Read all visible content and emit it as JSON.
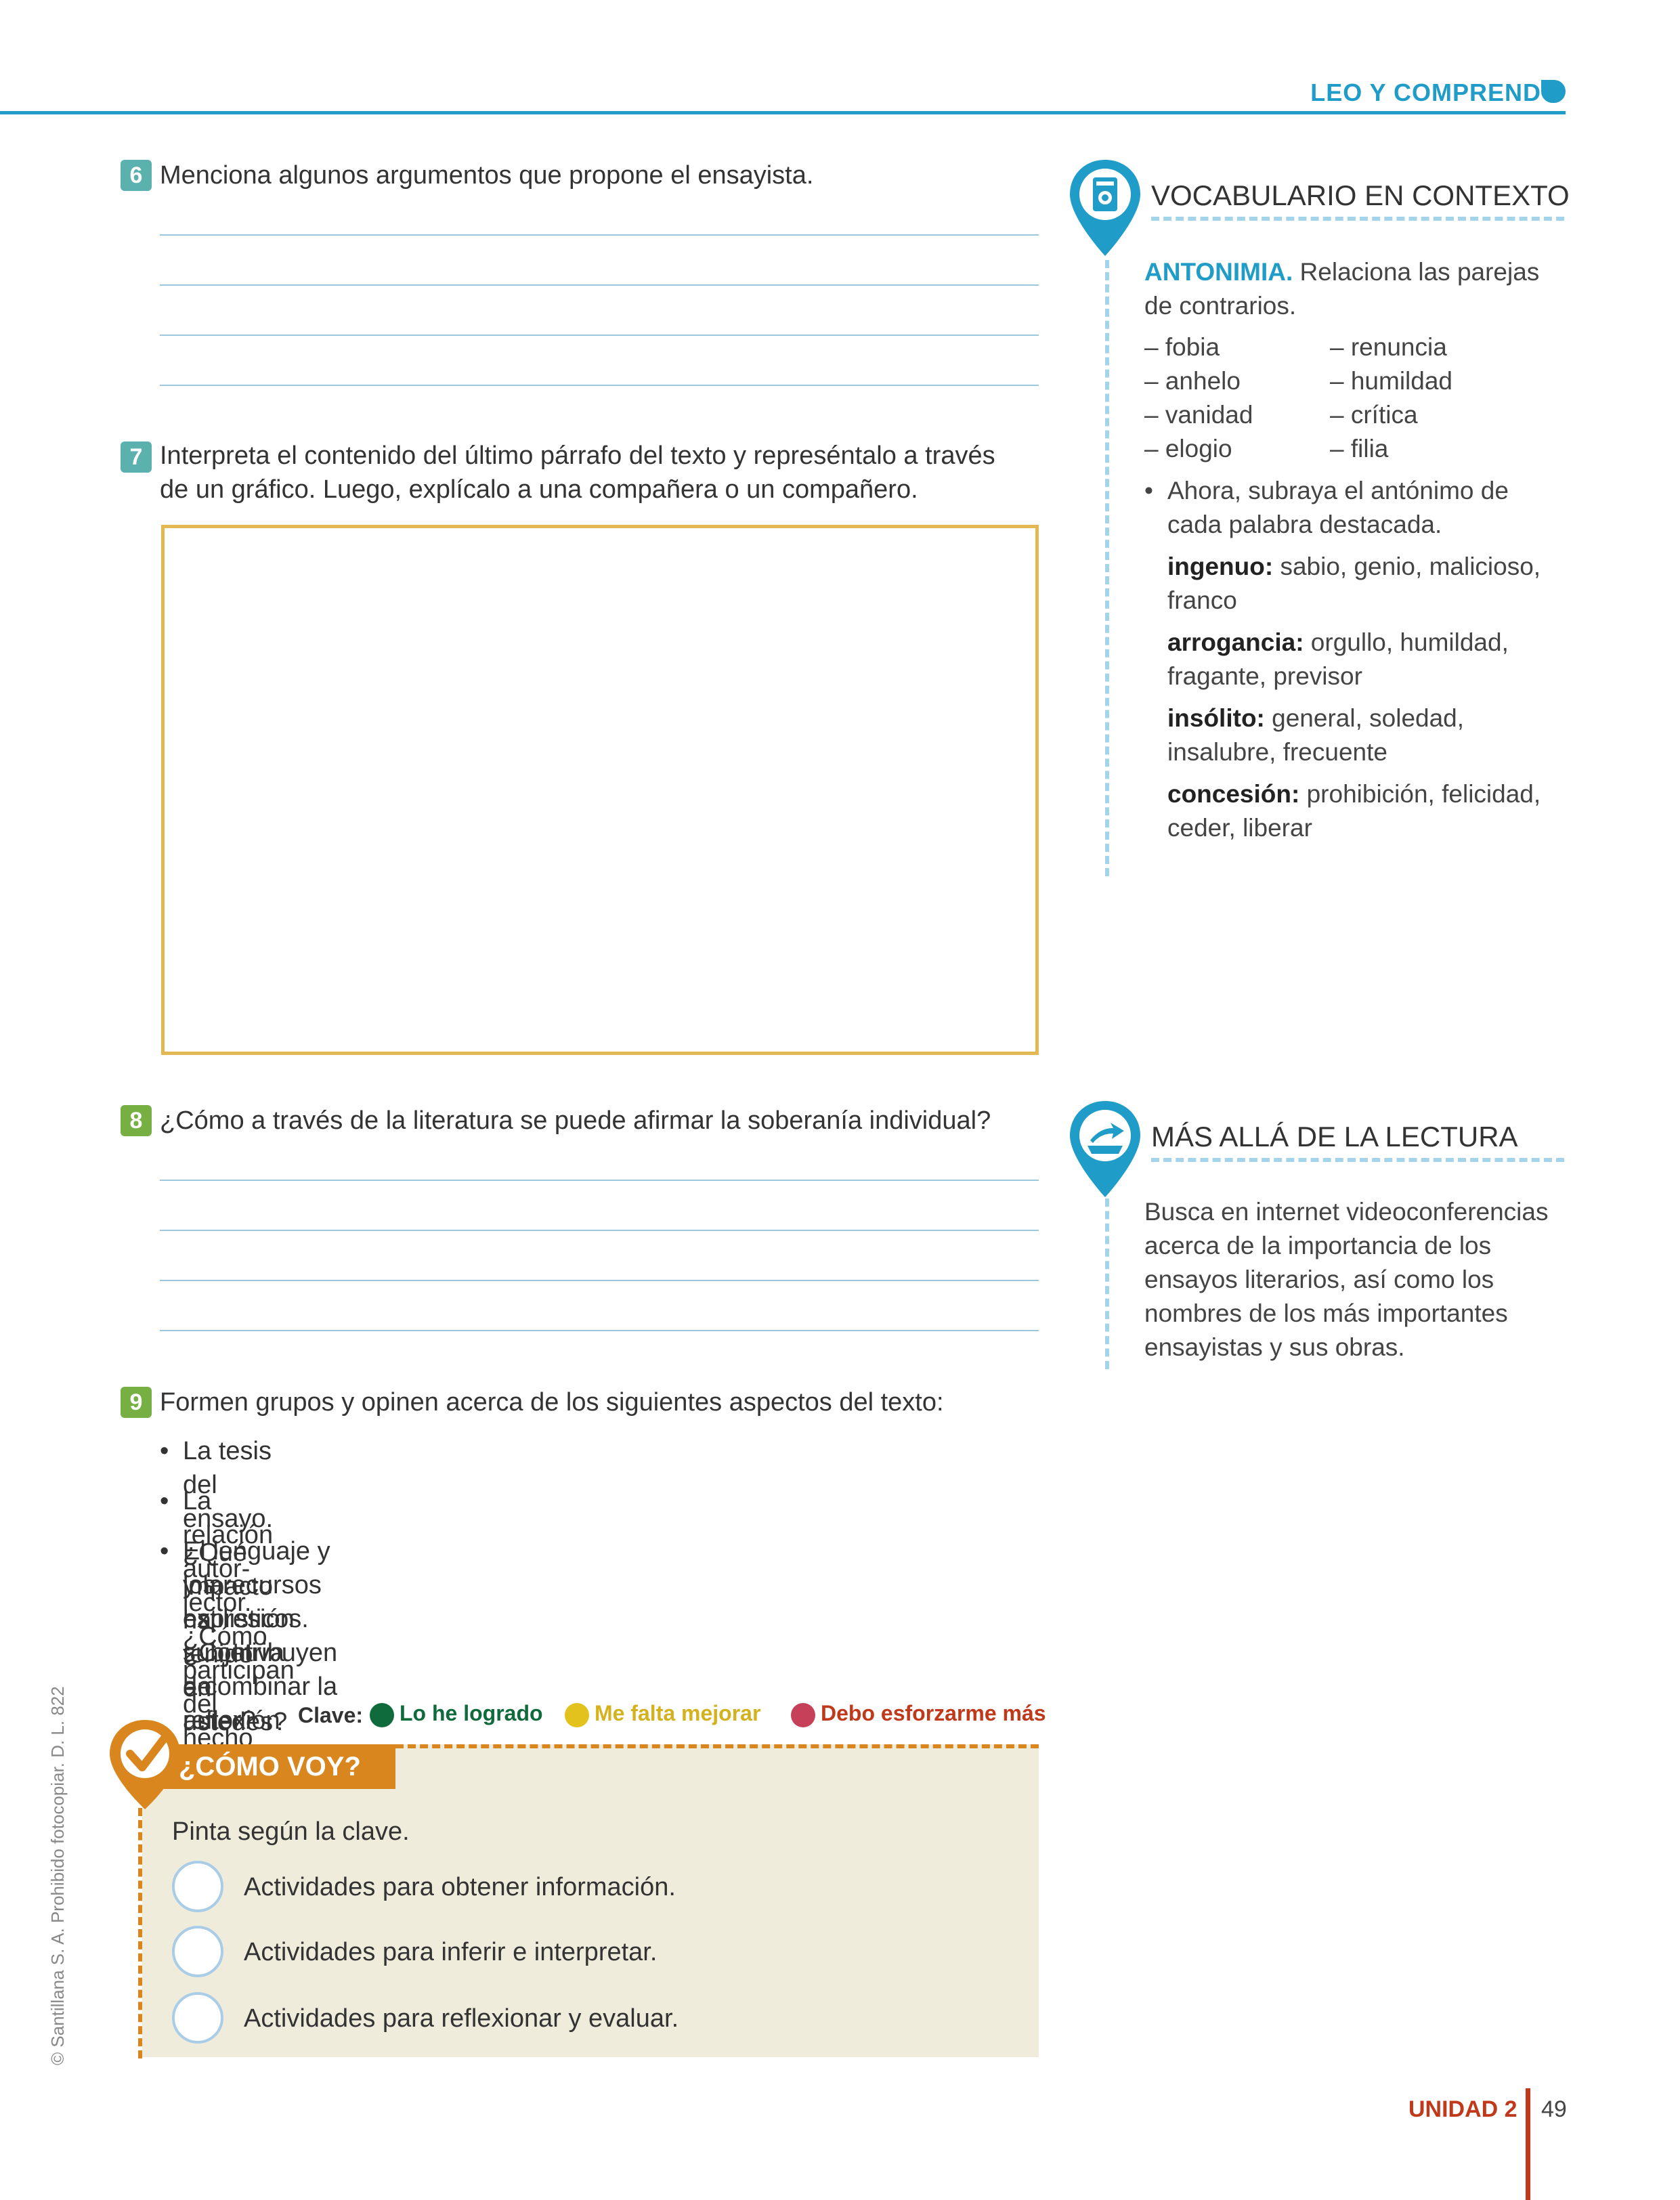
{
  "header": {
    "section_title": "LEO Y COMPRENDO"
  },
  "questions": [
    {
      "number": "6",
      "text": "Menciona algunos argumentos que propone el ensayista."
    },
    {
      "number": "7",
      "line1": "Interpreta el contenido del último párrafo del texto y represéntalo a través",
      "line2": "de un gráfico. Luego, explícalo a una compañera o un compañero."
    },
    {
      "number": "8",
      "text": "¿Cómo a través de la literatura se puede afirmar la soberanía individual?"
    },
    {
      "number": "9",
      "text": "Formen grupos y opinen acerca de los siguientes aspectos del texto:",
      "bullets": [
        "La tesis del ensayo. ¿Qué impacto ha tenido en ustedes?",
        "La relación autor-lector. ¿Cómo participan del hecho literario?",
        "El lenguaje y los recursos estilísticos. ¿Contribuyen a combinar la reflexión",
        "y la expresión subjetiva del autor?"
      ]
    }
  ],
  "vocabulario": {
    "title": "VOCABULARIO EN CONTEXTO",
    "heading": "ANTONIMIA.",
    "intro1": " Relaciona las parejas",
    "intro2": "de contrarios.",
    "left_words": [
      "– fobia",
      "– anhelo",
      "– vanidad",
      "– elogio"
    ],
    "right_words": [
      "– renuncia",
      "– humildad",
      "– crítica",
      "– filia"
    ],
    "bullet1": "Ahora, subraya el antónimo de",
    "bullet2": "cada palabra destacada.",
    "terms": [
      {
        "word": "ingenuo:",
        "rest1": " sabio, genio, malicioso,",
        "rest2": "franco"
      },
      {
        "word": "arrogancia:",
        "rest1": " orgullo, humildad,",
        "rest2": "fragante, previsor"
      },
      {
        "word": "insólito:",
        "rest1": " general, soledad,",
        "rest2": "insalubre, frecuente"
      },
      {
        "word": "concesión:",
        "rest1": " prohibición, felicidad,",
        "rest2": "ceder, liberar"
      }
    ]
  },
  "mas_alla": {
    "title": "MÁS ALLÁ DE LA LECTURA",
    "lines": [
      "Busca en internet videoconferencias",
      "acerca de la importancia de los",
      "ensayos literarios, así como los",
      "nombres de los más importantes",
      "ensayistas y sus obras."
    ]
  },
  "como_voy": {
    "key_label": "Clave:",
    "key_items": [
      {
        "label": "Lo he logrado",
        "color": "#0f6b3b"
      },
      {
        "label": "Me falta mejorar",
        "color": "#e3c21e"
      },
      {
        "label": "Debo esforzarme más",
        "color": "#c7405a"
      }
    ],
    "title": "¿CÓMO VOY?",
    "instruction": "Pinta según la clave.",
    "activities": [
      "Actividades para obtener información.",
      "Actividades para inferir e interpretar.",
      "Actividades para reflexionar y evaluar."
    ]
  },
  "copyright": "© Santillana S. A. Prohibido fotocopiar. D. L. 822",
  "footer": {
    "unit": "UNIDAD 2",
    "page": "49"
  },
  "colors": {
    "accent_blue": "#1f9cc8",
    "orange": "#d9861e",
    "box_yellow": "#e2b853",
    "red": "#c0391b"
  }
}
